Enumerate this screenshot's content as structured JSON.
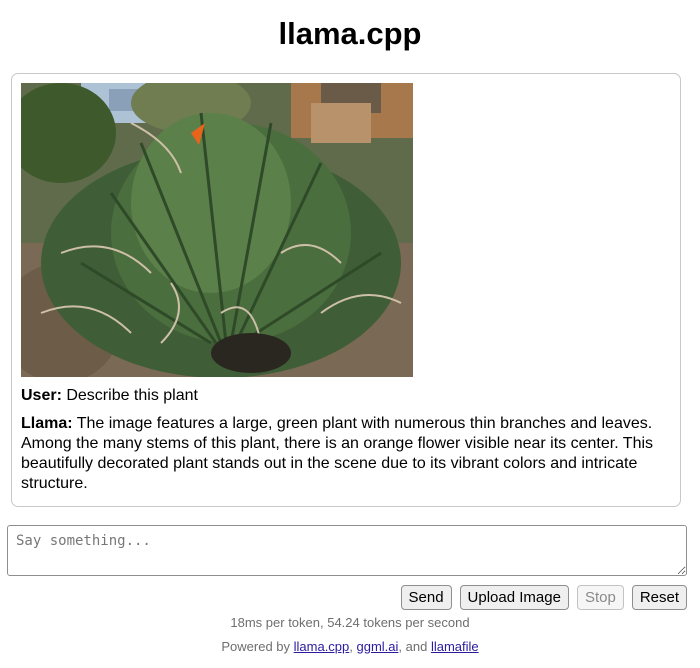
{
  "header": {
    "title": "llama.cpp"
  },
  "conversation": {
    "image": {
      "description_icon": "plant-photo"
    },
    "messages": [
      {
        "speaker": "User:",
        "text": " Describe this plant"
      },
      {
        "speaker": "Llama:",
        "text": " The image features a large, green plant with numerous thin branches and leaves. Among the many stems of this plant, there is an orange flower visible near its center. This beautifully decorated plant stands out in the scene due to its vibrant colors and intricate structure."
      }
    ]
  },
  "composer": {
    "placeholder": "Say something..."
  },
  "buttons": {
    "send": "Send",
    "upload": "Upload Image",
    "stop": "Stop",
    "reset": "Reset"
  },
  "footer": {
    "stats": "18ms per token, 54.24 tokens per second",
    "powered_prefix": "Powered by ",
    "link1": "llama.cpp",
    "sep1": ", ",
    "link2": "ggml.ai",
    "sep2": ", and ",
    "link3": "llamafile"
  },
  "colors": {
    "link": "#2a1b9e",
    "muted": "#6e6e6e"
  }
}
